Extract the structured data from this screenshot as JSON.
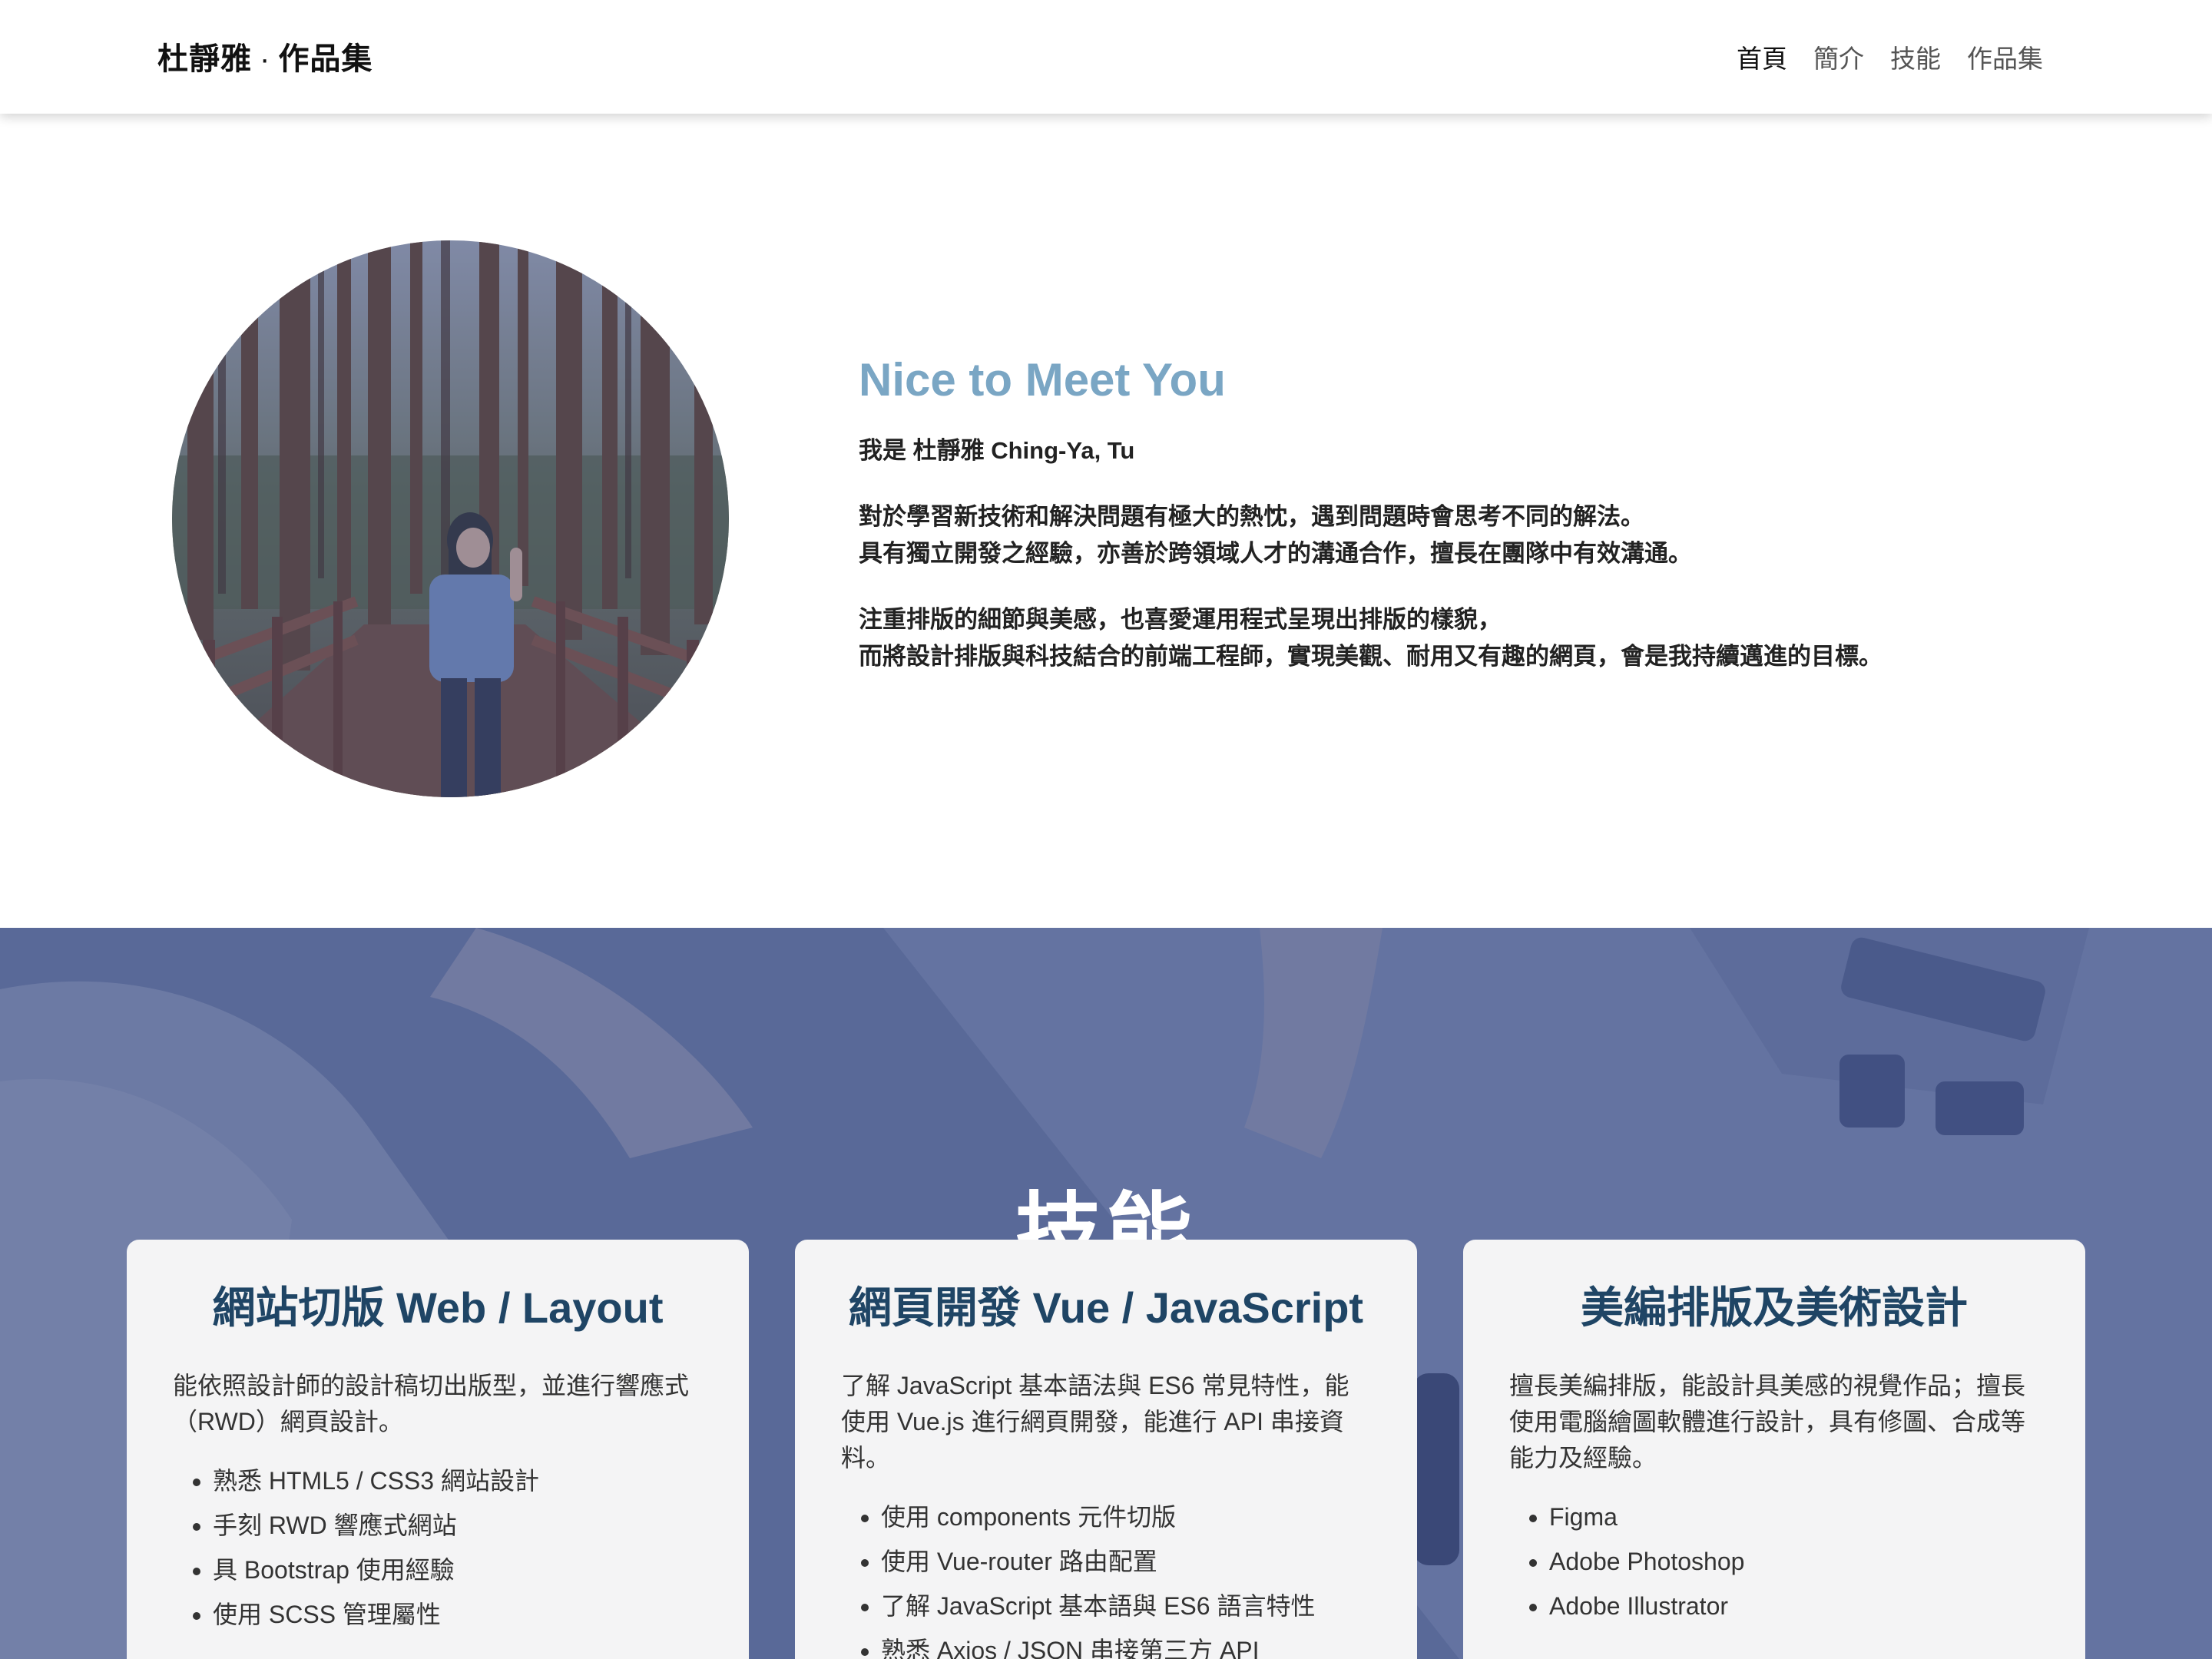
{
  "navbar": {
    "brand_name": "杜靜雅",
    "brand_sep": "·",
    "brand_suffix": "作品集",
    "links": [
      {
        "label": "首頁",
        "active": true
      },
      {
        "label": "簡介",
        "active": false
      },
      {
        "label": "技能",
        "active": false
      },
      {
        "label": "作品集",
        "active": false
      }
    ]
  },
  "about": {
    "heading": "Nice to Meet You",
    "intro": "我是 杜靜雅 Ching-Ya, Tu",
    "paragraph1_line1": "對於學習新技術和解決問題有極大的熱忱，遇到問題時會思考不同的解法。",
    "paragraph1_line2": "具有獨立開發之經驗，亦善於跨領域人才的溝通合作，擅長在團隊中有效溝通。",
    "paragraph2_line1": "注重排版的細節與美感，也喜愛運用程式呈現出排版的樣貌，",
    "paragraph2_line2": "而將設計排版與科技結合的前端工程師，實現美觀、耐用又有趣的網頁，會是我持續邁進的目標。"
  },
  "skills": {
    "title": "技能",
    "cards": [
      {
        "title": "網站切版 Web / Layout",
        "desc": "能依照設計師的設計稿切出版型，並進行響應式（RWD）網頁設計。",
        "items": [
          "熟悉 HTML5 / CSS3 網站設計",
          "手刻 RWD 響應式網站",
          "具 Bootstrap 使用經驗",
          "使用 SCSS 管理屬性"
        ]
      },
      {
        "title": "網頁開發 Vue / JavaScript",
        "desc": "了解 JavaScript 基本語法與 ES6 常見特性，能使用 Vue.js 進行網頁開發，能進行 API 串接資料。",
        "items": [
          "使用 components 元件切版",
          "使用 Vue-router 路由配置",
          "了解 JavaScript 基本語與 ES6 語言特性",
          "熟悉 Axios / JSON 串接第三方 API"
        ]
      },
      {
        "title": "美編排版及美術設計",
        "desc": "擅長美編排版，能設計具美感的視覺作品；擅長使用電腦繪圖軟體進行設計，具有修圖、合成等能力及經驗。",
        "items": [
          "Figma",
          "Adobe Photoshop",
          "Adobe Illustrator"
        ]
      }
    ]
  },
  "colors": {
    "heading_accent": "#7aa6c4",
    "card_title": "#1f4565",
    "skills_overlay": "#5b6a93"
  }
}
